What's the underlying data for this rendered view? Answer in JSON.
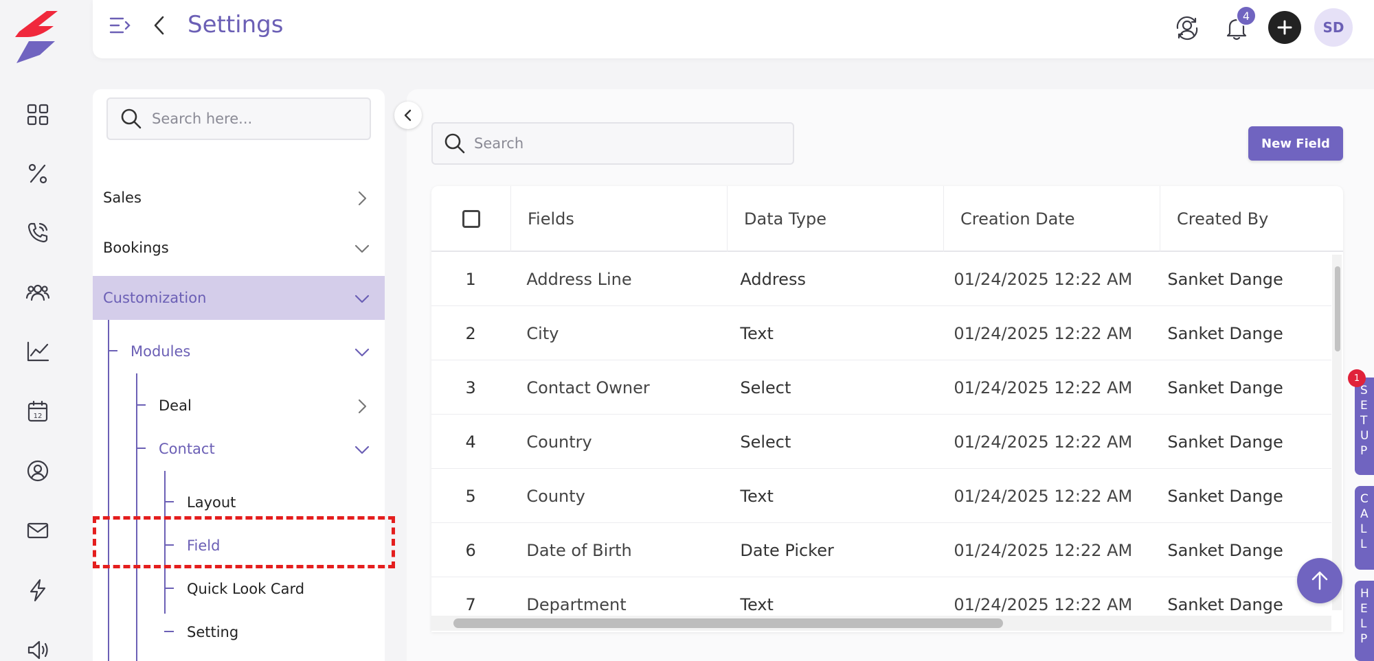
{
  "header": {
    "title": "Settings",
    "notification_count": "4",
    "avatar_initials": "SD"
  },
  "rail": {
    "items": [
      "dashboard-icon",
      "percent-icon",
      "phone-icon",
      "users-icon",
      "chart-icon",
      "calendar-icon",
      "contact-icon",
      "mail-icon",
      "bolt-icon",
      "speaker-icon"
    ]
  },
  "sidebar": {
    "search_placeholder": "Search here...",
    "items": {
      "sales": "Sales",
      "bookings": "Bookings",
      "customization": "Customization",
      "modules": "Modules",
      "deal": "Deal",
      "contact": "Contact",
      "layout": "Layout",
      "field": "Field",
      "quick_look_card": "Quick Look Card",
      "setting": "Setting"
    }
  },
  "main": {
    "search_placeholder": "Search",
    "new_field_label": "New Field",
    "columns": [
      "Fields",
      "Data Type",
      "Creation Date",
      "Created By"
    ],
    "rows": [
      {
        "n": "1",
        "field": "Address Line",
        "type": "Address",
        "date": "01/24/2025 12:22 AM",
        "by": "Sanket Dange"
      },
      {
        "n": "2",
        "field": "City",
        "type": "Text",
        "date": "01/24/2025 12:22 AM",
        "by": "Sanket Dange"
      },
      {
        "n": "3",
        "field": "Contact Owner",
        "type": "Select",
        "date": "01/24/2025 12:22 AM",
        "by": "Sanket Dange"
      },
      {
        "n": "4",
        "field": "Country",
        "type": "Select",
        "date": "01/24/2025 12:22 AM",
        "by": "Sanket Dange"
      },
      {
        "n": "5",
        "field": "County",
        "type": "Text",
        "date": "01/24/2025 12:22 AM",
        "by": "Sanket Dange"
      },
      {
        "n": "6",
        "field": "Date of Birth",
        "type": "Date Picker",
        "date": "01/24/2025 12:22 AM",
        "by": "Sanket Dange"
      },
      {
        "n": "7",
        "field": "Department",
        "type": "Text",
        "date": "01/24/2025 12:22 AM",
        "by": "Sanket Dange"
      }
    ]
  },
  "side_tabs": {
    "badge": "1",
    "tab1": "S\nE\nT\nU\nP",
    "tab2": "C\nA\nL\nL",
    "tab3": "H\nE\nL\nP"
  },
  "colors": {
    "accent": "#7064c0",
    "title": "#6b5fb5",
    "active_bg": "#d4cdea",
    "highlight": "#e41e1e"
  }
}
